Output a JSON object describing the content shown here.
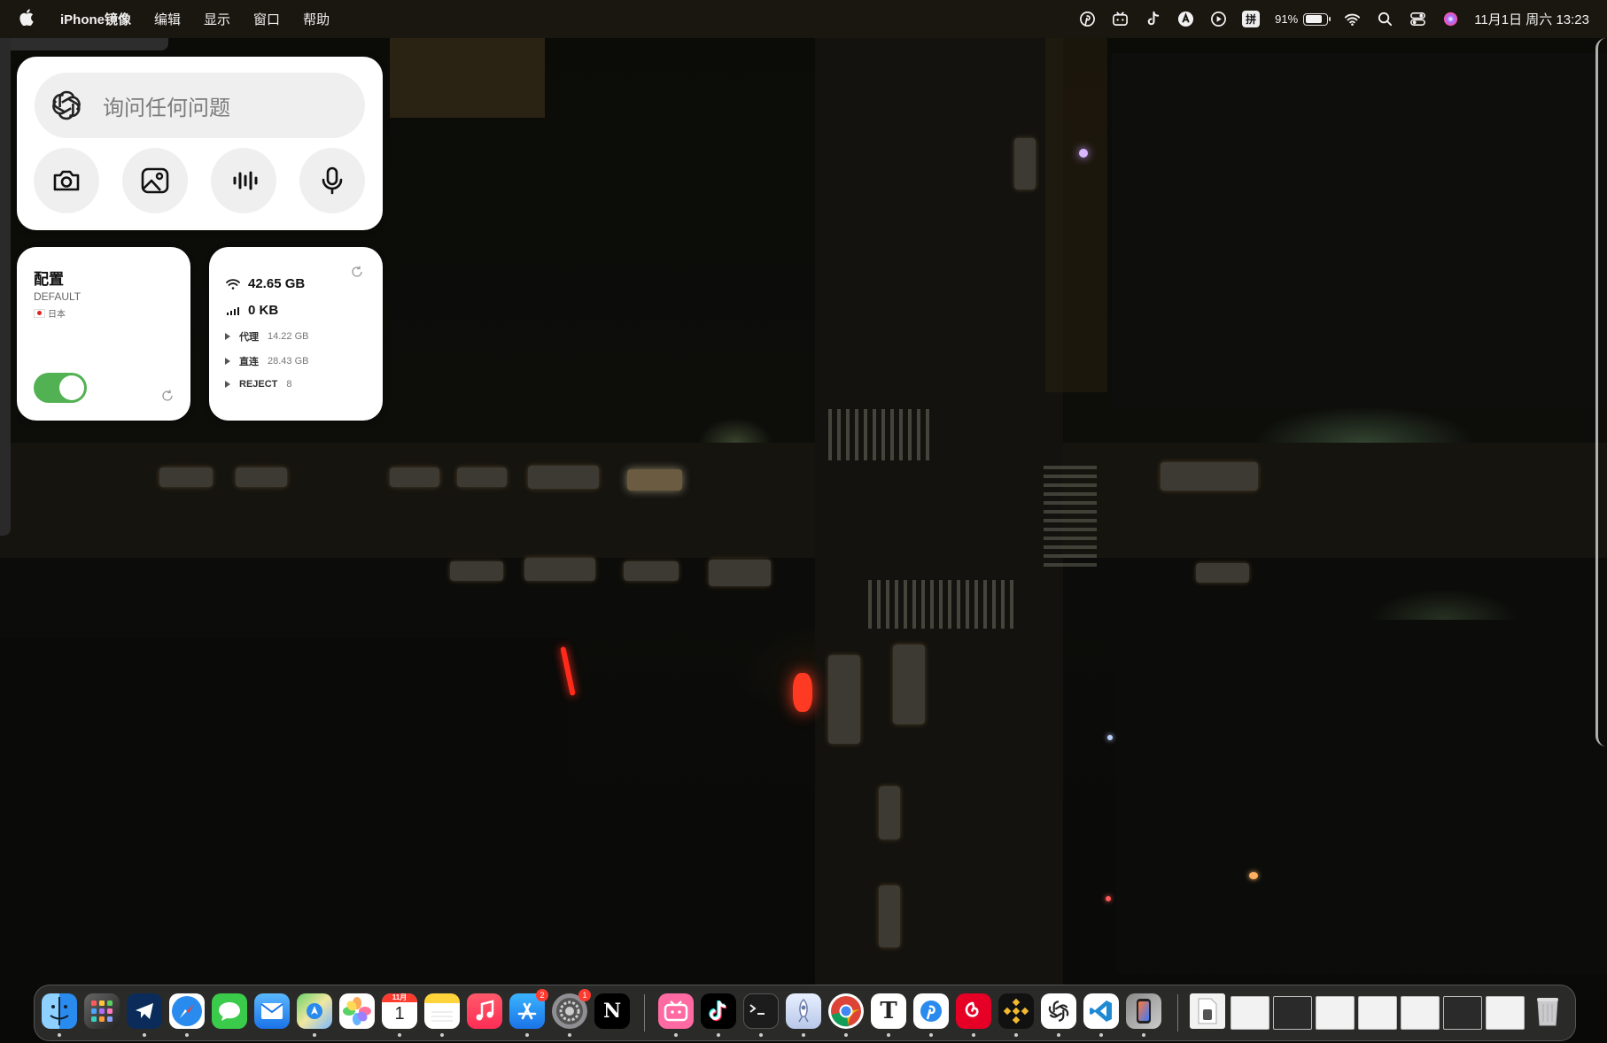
{
  "menubar": {
    "apple_icon": "apple-logo",
    "app_name": "iPhone镜像",
    "menus": [
      "编辑",
      "显示",
      "窗口",
      "帮助"
    ],
    "status_icons": [
      "pinterest-icon",
      "bilibili-icon",
      "tiktok-icon",
      "alert-icon",
      "play-icon"
    ],
    "input_method": "拼",
    "battery_percent": "91%",
    "battery_level": 0.91,
    "datetime": "11月1日 周六 13:23"
  },
  "chatgpt_widget": {
    "placeholder": "询问任何问题",
    "buttons": [
      "camera-icon",
      "photo-icon",
      "voice-wave-icon",
      "microphone-icon"
    ]
  },
  "config_widget": {
    "title": "配置",
    "profile": "DEFAULT",
    "region": "日本",
    "enabled": true
  },
  "traffic_widget": {
    "wifi_total": "42.65 GB",
    "cellular_total": "0 KB",
    "rows": [
      {
        "label": "代理",
        "value": "14.22 GB"
      },
      {
        "label": "直连",
        "value": "28.43 GB"
      },
      {
        "label": "REJECT",
        "value": "8"
      }
    ]
  },
  "dock": {
    "calendar_month": "11月",
    "calendar_day": "1",
    "appstore_badge": "2",
    "settings_badge": "1",
    "apps": [
      "Finder",
      "Launchpad",
      "Telegram",
      "Safari",
      "Messages",
      "Mail",
      "Maps",
      "Photos",
      "Calendar",
      "Notes",
      "Music",
      "App Store",
      "System Settings",
      "Notion",
      "bilibili",
      "TikTok",
      "Terminal",
      "Rocket",
      "Chrome",
      "Typora",
      "Pinterest",
      "NetEase Music",
      "Binance",
      "ChatGPT",
      "VS Code",
      "iPhone Mirroring"
    ]
  }
}
